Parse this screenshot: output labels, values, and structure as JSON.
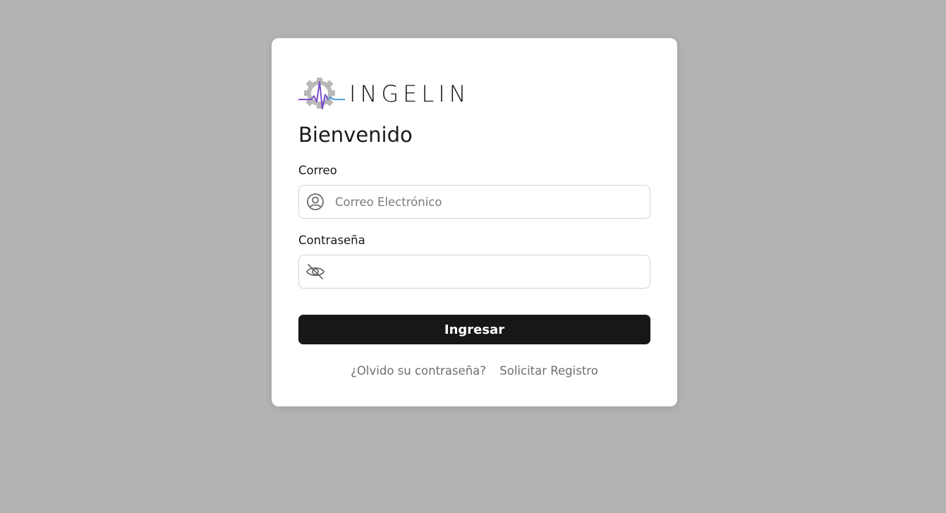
{
  "brand": {
    "name": "INGELIN",
    "colors": {
      "gear": "#b8b8b8",
      "pulse_purple": "#7a4fc8",
      "pulse_blue": "#4aa3df"
    }
  },
  "login": {
    "title": "Bienvenido",
    "email": {
      "label": "Correo",
      "placeholder": "Correo Electrónico",
      "value": "",
      "icon": "user-circle-icon"
    },
    "password": {
      "label": "Contraseña",
      "placeholder": "",
      "value": "",
      "icon": "eye-off-icon"
    },
    "submit_label": "Ingresar",
    "forgot_link": "¿Olvido su contraseña?",
    "register_link": "Solicitar Registro"
  },
  "theme": {
    "background": "#b3b3b3",
    "card": "#ffffff",
    "button": "#171717"
  }
}
